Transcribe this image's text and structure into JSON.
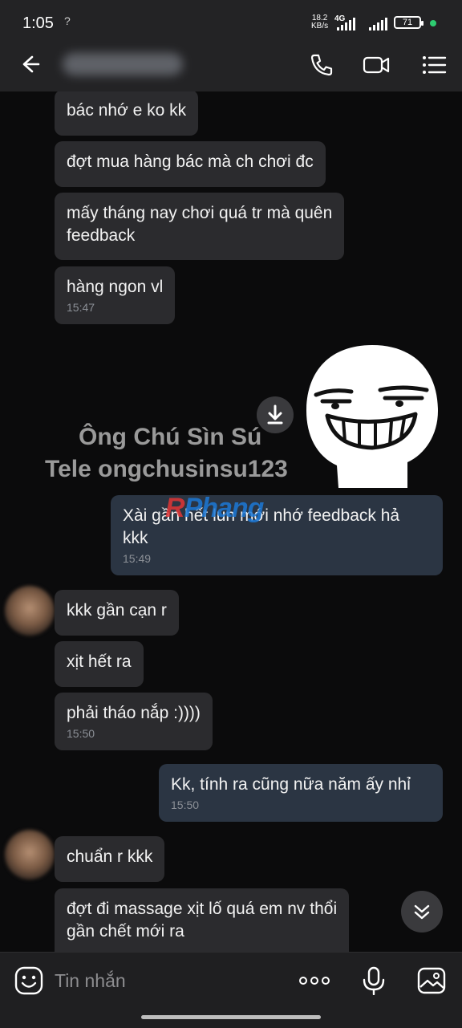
{
  "status_bar": {
    "time": "1:05",
    "sim_indicator": "?",
    "data_rate_value": "18.2",
    "data_rate_unit": "KB/s",
    "network_type": "4G",
    "battery_level": "71",
    "icons": [
      "signal-icon",
      "battery-icon",
      "dot-indicator"
    ]
  },
  "header": {
    "icons": [
      "back-arrow-icon",
      "phone-icon",
      "video-call-icon",
      "menu-icon"
    ]
  },
  "messages": [
    {
      "direction": "in",
      "text": "bác nhớ e ko kk",
      "time": ""
    },
    {
      "direction": "in",
      "text": "đợt mua hàng bác mà ch chơi đc",
      "time": ""
    },
    {
      "direction": "in",
      "text": "mấy tháng nay chơi quá tr mà quên\nfeedback",
      "time": ""
    },
    {
      "direction": "in",
      "text": "hàng ngon vl",
      "time": "15:47"
    },
    {
      "direction": "out",
      "text": "Xài gần hết lun mới nhớ feedback hả\nkkk",
      "time": "15:49"
    },
    {
      "direction": "in",
      "text": "kkk gần cạn r",
      "time": ""
    },
    {
      "direction": "in",
      "text": "xịt hết ra",
      "time": ""
    },
    {
      "direction": "in",
      "text": "phải tháo nắp :))))",
      "time": "15:50"
    },
    {
      "direction": "out",
      "text": "Kk, tính ra cũng nữa năm ấy nhỉ",
      "time": "15:50"
    },
    {
      "direction": "in",
      "text": "chuẩn r kkk",
      "time": ""
    },
    {
      "direction": "in",
      "text": "đợt đi massage xịt lố quá em nv thổi\ngần chết mới ra",
      "time": ""
    }
  ],
  "watermark": {
    "line1": "Ông Chú Sìn Sú",
    "line2": "Tele ongchusinsu123",
    "logo": "Phang"
  },
  "composer": {
    "placeholder": "Tin nhắn",
    "icons": [
      "emoji-icon",
      "more-options-icon",
      "microphone-icon",
      "image-icon"
    ]
  },
  "colors": {
    "background": "#0b0b0c",
    "bar": "#232325",
    "incoming_bubble": "#2b2b2e",
    "outgoing_bubble": "#2b3543",
    "status_dot": "#2ecc71"
  }
}
